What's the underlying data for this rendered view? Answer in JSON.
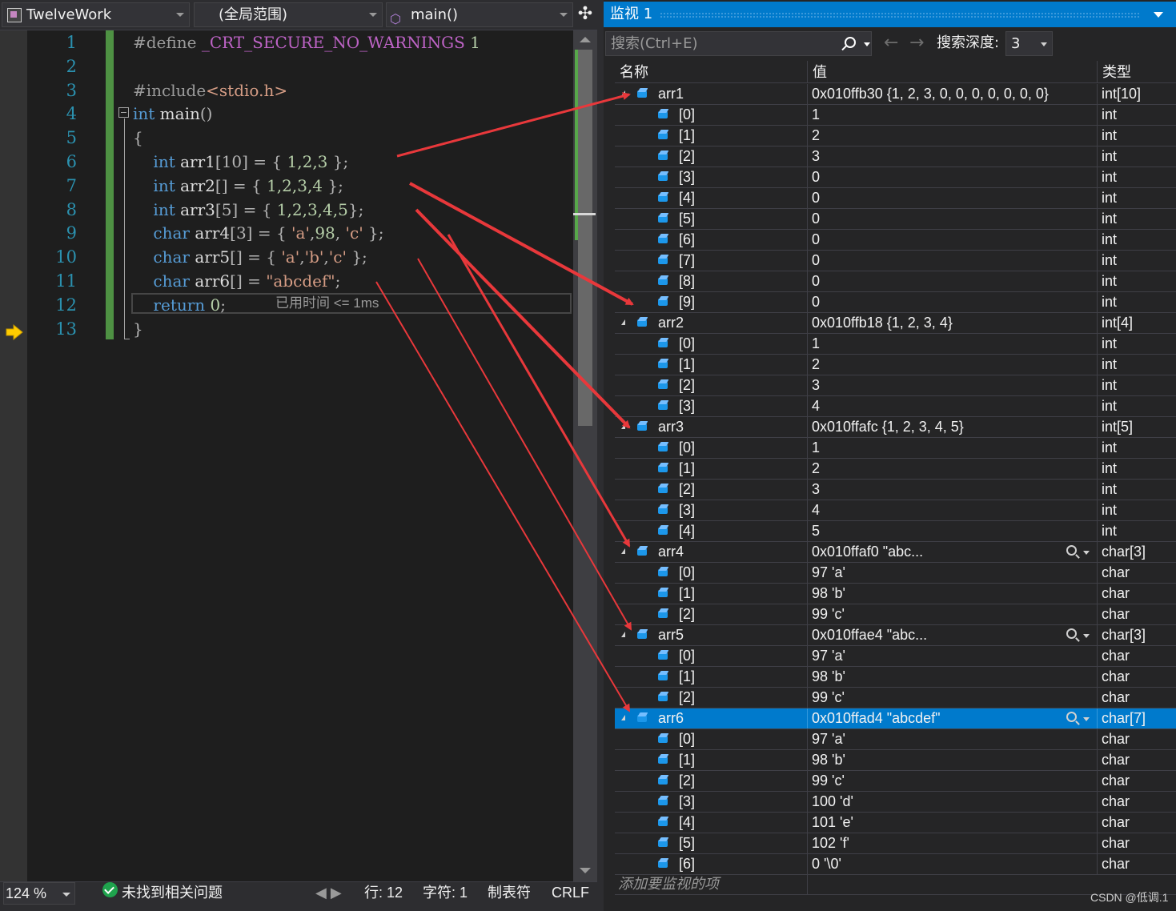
{
  "editor": {
    "nav": {
      "project": "TwelveWork",
      "scope": "(全局范围)",
      "function": "main()"
    },
    "line_numbers": [
      "1",
      "2",
      "3",
      "4",
      "5",
      "6",
      "7",
      "8",
      "9",
      "10",
      "11",
      "12",
      "13"
    ],
    "code": [
      [
        {
          "t": "#define ",
          "c": "pre"
        },
        {
          "t": "_CRT_SECURE_NO_WARNINGS",
          "c": "macro"
        },
        {
          "t": " 1",
          "c": "num"
        }
      ],
      [],
      [
        {
          "t": "#include",
          "c": "pre"
        },
        {
          "t": "<stdio.h>",
          "c": "str"
        }
      ],
      [
        {
          "t": "int",
          "c": "kw"
        },
        {
          "t": " main",
          "c": "id"
        },
        {
          "t": "()",
          "c": "br"
        }
      ],
      [
        {
          "t": "{",
          "c": "br"
        }
      ],
      [
        {
          "t": "    int",
          "c": "kw"
        },
        {
          "t": " arr1",
          "c": "id"
        },
        {
          "t": "[10]",
          "c": "br"
        },
        {
          "t": " = { ",
          "c": "punct"
        },
        {
          "t": "1,2,3",
          "c": "num"
        },
        {
          "t": " };",
          "c": "punct"
        }
      ],
      [
        {
          "t": "    int",
          "c": "kw"
        },
        {
          "t": " arr2",
          "c": "id"
        },
        {
          "t": "[]",
          "c": "br"
        },
        {
          "t": " = { ",
          "c": "punct"
        },
        {
          "t": "1,2,3,4",
          "c": "num"
        },
        {
          "t": " };",
          "c": "punct"
        }
      ],
      [
        {
          "t": "    int",
          "c": "kw"
        },
        {
          "t": " arr3",
          "c": "id"
        },
        {
          "t": "[5]",
          "c": "br"
        },
        {
          "t": " = { ",
          "c": "punct"
        },
        {
          "t": "1,2,3,4,5",
          "c": "num"
        },
        {
          "t": "};",
          "c": "punct"
        }
      ],
      [
        {
          "t": "    char",
          "c": "kw"
        },
        {
          "t": " arr4",
          "c": "id"
        },
        {
          "t": "[3]",
          "c": "br"
        },
        {
          "t": " = { ",
          "c": "punct"
        },
        {
          "t": "'a'",
          "c": "str"
        },
        {
          "t": ",",
          "c": "punct"
        },
        {
          "t": "98",
          "c": "num"
        },
        {
          "t": ", ",
          "c": "punct"
        },
        {
          "t": "'c'",
          "c": "str"
        },
        {
          "t": " };",
          "c": "punct"
        }
      ],
      [
        {
          "t": "    char",
          "c": "kw"
        },
        {
          "t": " arr5",
          "c": "id"
        },
        {
          "t": "[]",
          "c": "br"
        },
        {
          "t": " = { ",
          "c": "punct"
        },
        {
          "t": "'a'",
          "c": "str"
        },
        {
          "t": ",",
          "c": "punct"
        },
        {
          "t": "'b'",
          "c": "str"
        },
        {
          "t": ",",
          "c": "punct"
        },
        {
          "t": "'c'",
          "c": "str"
        },
        {
          "t": " };",
          "c": "punct"
        }
      ],
      [
        {
          "t": "    char",
          "c": "kw"
        },
        {
          "t": " arr6",
          "c": "id"
        },
        {
          "t": "[]",
          "c": "br"
        },
        {
          "t": " = ",
          "c": "punct"
        },
        {
          "t": "\"abcdef\"",
          "c": "str"
        },
        {
          "t": ";",
          "c": "punct"
        }
      ],
      [
        {
          "t": "    return",
          "c": "kw"
        },
        {
          "t": " 0",
          "c": "num"
        },
        {
          "t": ";",
          "c": "punct"
        }
      ],
      [
        {
          "t": "}",
          "c": "br"
        }
      ]
    ],
    "perf_tip": "已用时间 <= 1ms",
    "current_line": 12
  },
  "status": {
    "zoom": "124 %",
    "issues": "未找到相关问题",
    "line": "行: 12",
    "char": "字符: 1",
    "tabs": "制表符",
    "eol": "CRLF"
  },
  "watch": {
    "title": "监视 1",
    "search_placeholder": "搜索(Ctrl+E)",
    "depth_label": "搜索深度:",
    "depth_value": "3",
    "columns": {
      "name": "名称",
      "value": "值",
      "type": "类型"
    },
    "rows": [
      {
        "level": 0,
        "expanded": true,
        "name": "arr1",
        "value": "0x010ffb30 {1, 2, 3, 0, 0, 0, 0, 0, 0, 0}",
        "type": "int[10]"
      },
      {
        "level": 1,
        "name": "[0]",
        "value": "1",
        "type": "int"
      },
      {
        "level": 1,
        "name": "[1]",
        "value": "2",
        "type": "int"
      },
      {
        "level": 1,
        "name": "[2]",
        "value": "3",
        "type": "int"
      },
      {
        "level": 1,
        "name": "[3]",
        "value": "0",
        "type": "int"
      },
      {
        "level": 1,
        "name": "[4]",
        "value": "0",
        "type": "int"
      },
      {
        "level": 1,
        "name": "[5]",
        "value": "0",
        "type": "int"
      },
      {
        "level": 1,
        "name": "[6]",
        "value": "0",
        "type": "int"
      },
      {
        "level": 1,
        "name": "[7]",
        "value": "0",
        "type": "int"
      },
      {
        "level": 1,
        "name": "[8]",
        "value": "0",
        "type": "int"
      },
      {
        "level": 1,
        "name": "[9]",
        "value": "0",
        "type": "int"
      },
      {
        "level": 0,
        "expanded": true,
        "name": "arr2",
        "value": "0x010ffb18 {1, 2, 3, 4}",
        "type": "int[4]"
      },
      {
        "level": 1,
        "name": "[0]",
        "value": "1",
        "type": "int"
      },
      {
        "level": 1,
        "name": "[1]",
        "value": "2",
        "type": "int"
      },
      {
        "level": 1,
        "name": "[2]",
        "value": "3",
        "type": "int"
      },
      {
        "level": 1,
        "name": "[3]",
        "value": "4",
        "type": "int"
      },
      {
        "level": 0,
        "expanded": true,
        "name": "arr3",
        "value": "0x010ffafc {1, 2, 3, 4, 5}",
        "type": "int[5]"
      },
      {
        "level": 1,
        "name": "[0]",
        "value": "1",
        "type": "int"
      },
      {
        "level": 1,
        "name": "[1]",
        "value": "2",
        "type": "int"
      },
      {
        "level": 1,
        "name": "[2]",
        "value": "3",
        "type": "int"
      },
      {
        "level": 1,
        "name": "[3]",
        "value": "4",
        "type": "int"
      },
      {
        "level": 1,
        "name": "[4]",
        "value": "5",
        "type": "int"
      },
      {
        "level": 0,
        "expanded": true,
        "viz": true,
        "name": "arr4",
        "value": "0x010ffaf0 \"abc...",
        "type": "char[3]"
      },
      {
        "level": 1,
        "name": "[0]",
        "value": "97 'a'",
        "type": "char"
      },
      {
        "level": 1,
        "name": "[1]",
        "value": "98 'b'",
        "type": "char"
      },
      {
        "level": 1,
        "name": "[2]",
        "value": "99 'c'",
        "type": "char"
      },
      {
        "level": 0,
        "expanded": true,
        "viz": true,
        "name": "arr5",
        "value": "0x010ffae4 \"abc...",
        "type": "char[3]"
      },
      {
        "level": 1,
        "name": "[0]",
        "value": "97 'a'",
        "type": "char"
      },
      {
        "level": 1,
        "name": "[1]",
        "value": "98 'b'",
        "type": "char"
      },
      {
        "level": 1,
        "name": "[2]",
        "value": "99 'c'",
        "type": "char"
      },
      {
        "level": 0,
        "expanded": true,
        "viz": true,
        "selected": true,
        "name": "arr6",
        "value": "0x010ffad4 \"abcdef\"",
        "type": "char[7]"
      },
      {
        "level": 1,
        "name": "[0]",
        "value": "97 'a'",
        "type": "char"
      },
      {
        "level": 1,
        "name": "[1]",
        "value": "98 'b'",
        "type": "char"
      },
      {
        "level": 1,
        "name": "[2]",
        "value": "99 'c'",
        "type": "char"
      },
      {
        "level": 1,
        "name": "[3]",
        "value": "100 'd'",
        "type": "char"
      },
      {
        "level": 1,
        "name": "[4]",
        "value": "101 'e'",
        "type": "char"
      },
      {
        "level": 1,
        "name": "[5]",
        "value": "102 'f'",
        "type": "char"
      },
      {
        "level": 1,
        "name": "[6]",
        "value": "0 '\\0'",
        "type": "char"
      }
    ],
    "add_placeholder": "添加要监视的项"
  },
  "watermark": "CSDN @低调.1",
  "colors": {
    "accent": "#007acc",
    "annotation_arrow": "#e8383b",
    "change_bar": "#57a64a",
    "keyword": "#569cd6",
    "string": "#d69d85",
    "number": "#b5cea8"
  }
}
